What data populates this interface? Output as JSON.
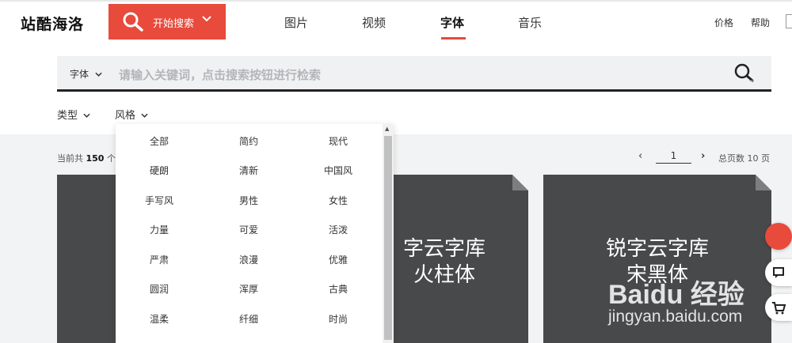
{
  "header": {
    "logo": "站酷海洛",
    "search_button": "开始搜索",
    "nav": [
      {
        "label": "图片",
        "active": false
      },
      {
        "label": "视频",
        "active": false
      },
      {
        "label": "字体",
        "active": true
      },
      {
        "label": "音乐",
        "active": false
      }
    ],
    "util": [
      "价格",
      "帮助"
    ],
    "accent_color": "#e84a3b"
  },
  "search": {
    "category": "字体",
    "placeholder": "请输入关键词，点击搜索按钮进行检索"
  },
  "filters": {
    "type_label": "类型",
    "style_label": "风格"
  },
  "style_options": [
    "全部",
    "简约",
    "现代",
    "硬朗",
    "清新",
    "中国风",
    "手写风",
    "男性",
    "女性",
    "力量",
    "可爱",
    "活泼",
    "严肃",
    "浪漫",
    "优雅",
    "圆润",
    "浑厚",
    "古典",
    "温柔",
    "纤细",
    "时尚"
  ],
  "results": {
    "prefix": "当前共",
    "count": "150",
    "suffix": "个"
  },
  "pager": {
    "current": "1",
    "total_text": "总页数 10 页"
  },
  "cards": [
    {
      "title": ""
    },
    {
      "title_line1": "字云字库",
      "title_line2": "火柱体"
    },
    {
      "title_line1": "锐字云字库",
      "title_line2": "宋黑体"
    }
  ],
  "watermark": {
    "brand": "Baidu 经验",
    "url": "jingyan.baidu.com"
  }
}
